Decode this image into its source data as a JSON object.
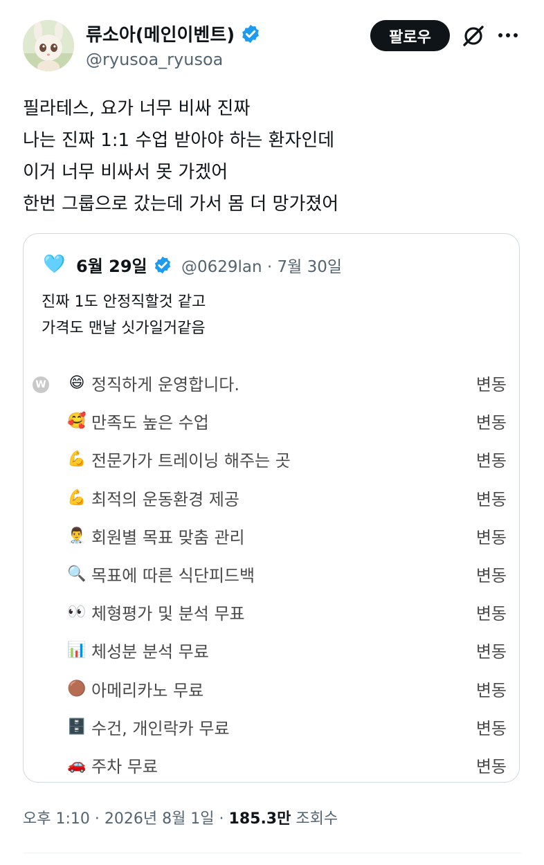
{
  "author": {
    "display_name": "류소아(메인이벤트)",
    "handle": "@ryusoa_ryusoa"
  },
  "header": {
    "follow_label": "팔로우",
    "icons": [
      "verified-badge-icon",
      "grok-icon",
      "more-icon"
    ]
  },
  "tweet": {
    "lines": [
      "필라테스, 요가 너무 비싸 진짜",
      "나는 진짜 1:1 수업 받아야 하는 환자인데",
      "이거 너무 비싸서 못 가겠어",
      "한번 그룹으로 갔는데 가서 몸 더 망가졌어"
    ]
  },
  "quote": {
    "heart": "🩵",
    "name": "6월 29일",
    "meta": "@0629lan · 7월 30일",
    "lines": [
      "진짜 1도 안정직할것 같고",
      "가격도 맨날 싯가일거같음"
    ],
    "badge": "W",
    "items": [
      {
        "emoji": "😄",
        "label": "정직하게 운영합니다.",
        "value": "변동"
      },
      {
        "emoji": "🥰",
        "label": "만족도 높은 수업",
        "value": "변동"
      },
      {
        "emoji": "💪",
        "label": "전문가가 트레이닝 해주는 곳",
        "value": "변동"
      },
      {
        "emoji": "💪",
        "label": "최적의 운동환경 제공",
        "value": "변동"
      },
      {
        "emoji": "👨‍⚕️",
        "label": "회원별 목표 맞춤 관리",
        "value": "변동"
      },
      {
        "emoji": "🔍",
        "label": "목표에 따른 식단피드백",
        "value": "변동"
      },
      {
        "emoji": "👀",
        "label": "체형평가 및 분석 무표",
        "value": "변동"
      },
      {
        "emoji": "📊",
        "label": "체성분 분석 무료",
        "value": "변동"
      },
      {
        "emoji": "🟤",
        "label": "아메리카노 무료",
        "value": "변동"
      },
      {
        "emoji": "🗄️",
        "label": "수건, 개인락카 무료",
        "value": "변동"
      },
      {
        "emoji": "🚗",
        "label": "주차 무료",
        "value": "변동"
      }
    ]
  },
  "footer": {
    "time": "오후 1:10 · 2026년 8월 1일 · ",
    "views_count": "185.3만",
    "views_label": " 조회수"
  },
  "colors": {
    "text": "#0f1419",
    "muted": "#536471",
    "verified": "#1d9bf0",
    "border": "#cfd9de"
  }
}
